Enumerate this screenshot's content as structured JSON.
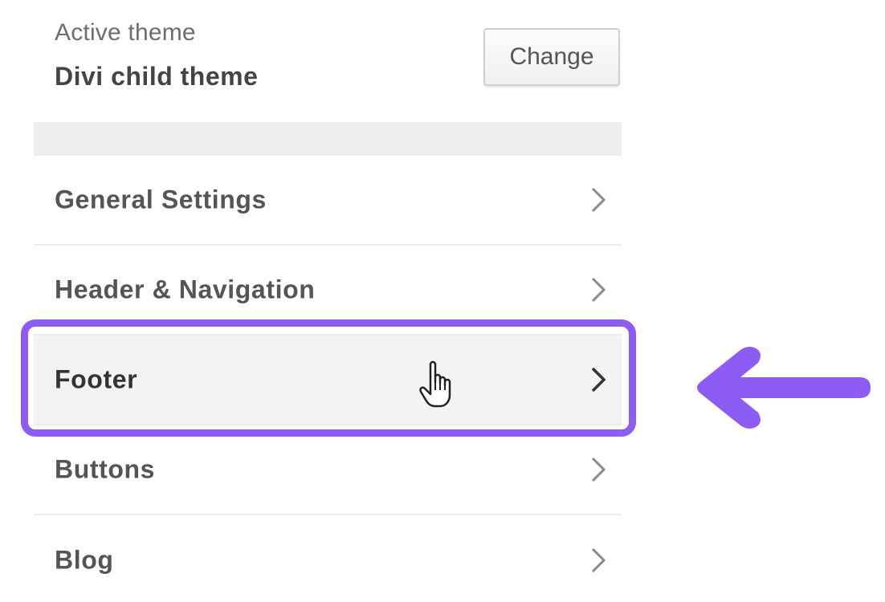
{
  "theme": {
    "caption": "Active theme",
    "name": "Divi child theme",
    "change_label": "Change"
  },
  "panels": [
    {
      "label": "General Settings",
      "active": false
    },
    {
      "label": "Header & Navigation",
      "active": false
    },
    {
      "label": "Footer",
      "active": true
    },
    {
      "label": "Buttons",
      "active": false
    },
    {
      "label": "Blog",
      "active": false
    }
  ],
  "colors": {
    "highlight": "#8c5cf5",
    "chevron": "#8a8a8a",
    "chevron_active": "#333333"
  },
  "icons": {
    "chevron": "chevron-right-icon",
    "cursor": "hand-pointer-icon",
    "arrow": "arrow-left-icon"
  }
}
